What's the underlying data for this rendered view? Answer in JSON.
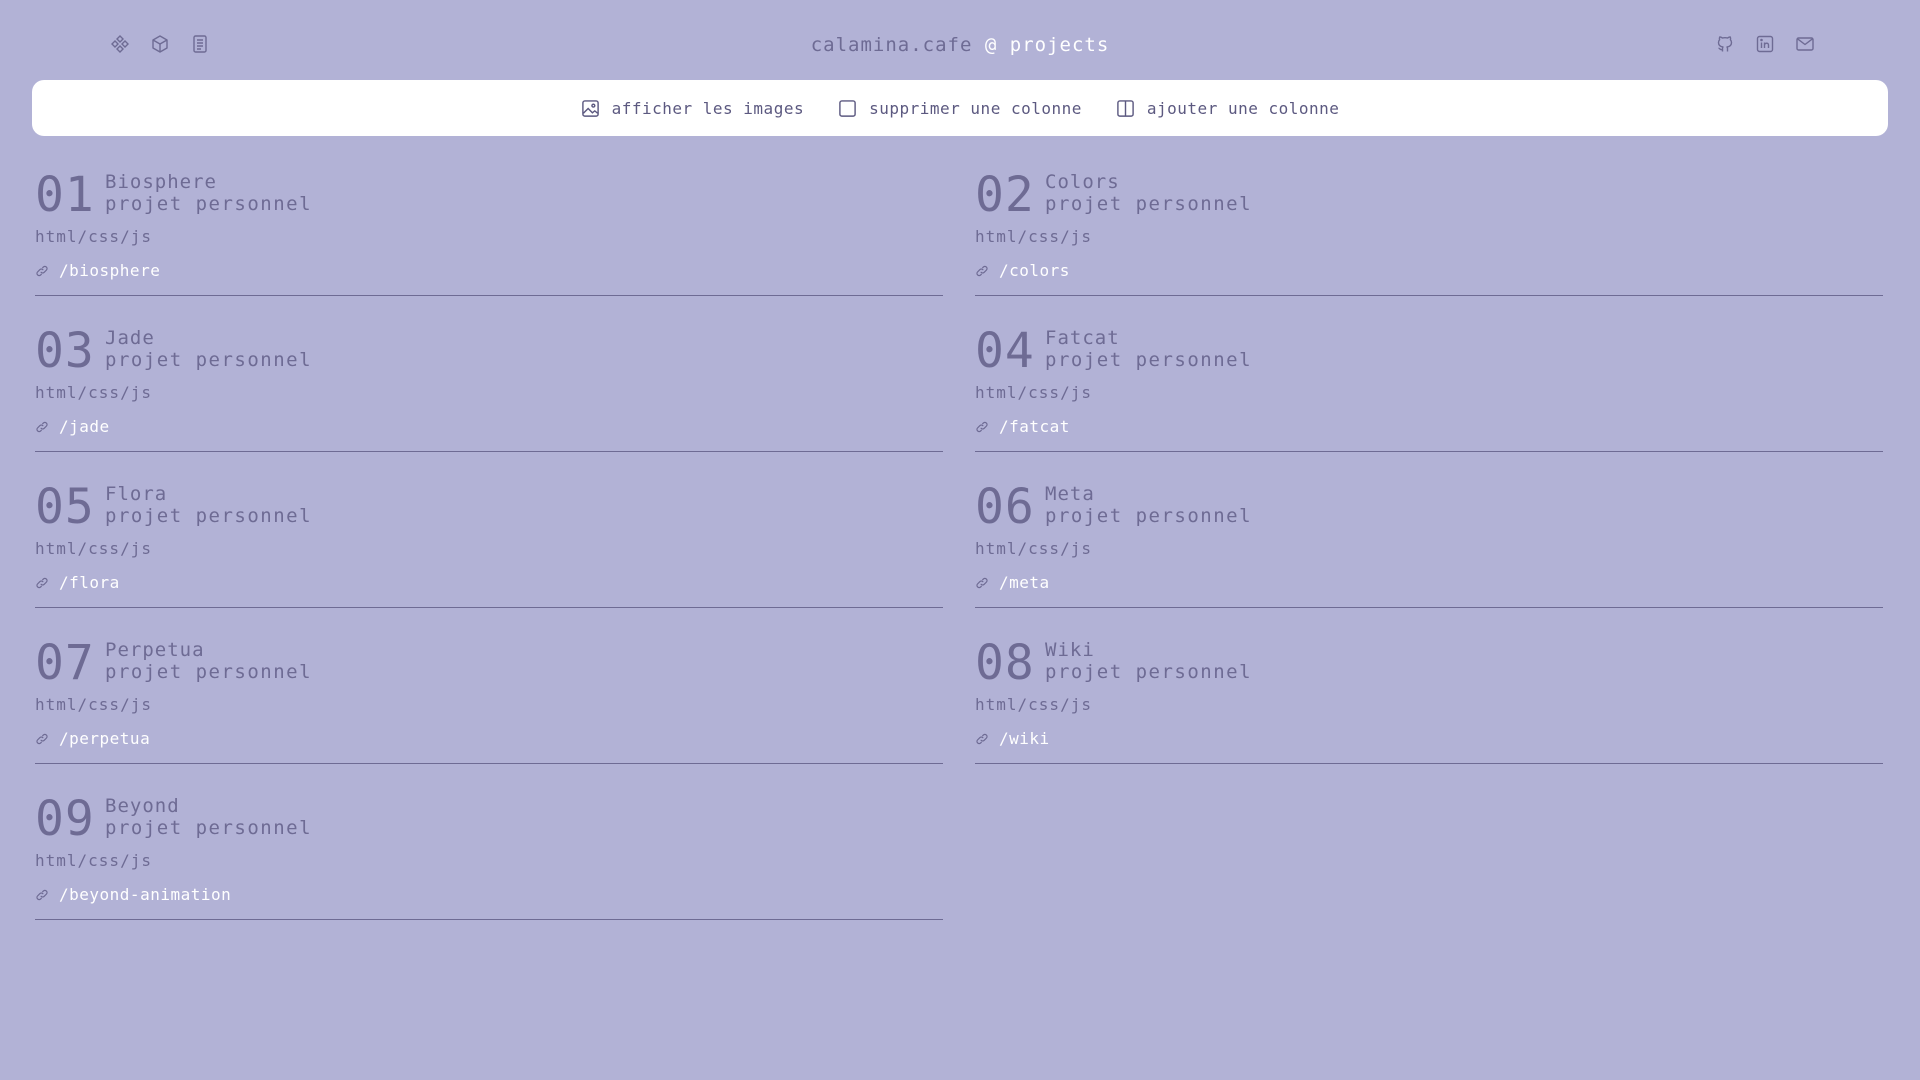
{
  "header": {
    "title_prefix": "calamina.cafe",
    "title_accent": "@ projects",
    "left_icons": [
      "diamonds-icon",
      "cube-icon",
      "document-icon"
    ],
    "right_icons": [
      "github-icon",
      "linkedin-icon",
      "mail-icon"
    ]
  },
  "toolbar": {
    "show_images": "afficher les images",
    "remove_column": "supprimer une colonne",
    "add_column": "ajouter une colonne"
  },
  "projects": [
    {
      "num": "01",
      "name": "Biosphere",
      "kind": "projet personnel",
      "tech": "html/css/js",
      "link": "/biosphere"
    },
    {
      "num": "02",
      "name": "Colors",
      "kind": "projet personnel",
      "tech": "html/css/js",
      "link": "/colors"
    },
    {
      "num": "03",
      "name": "Jade",
      "kind": "projet personnel",
      "tech": "html/css/js",
      "link": "/jade"
    },
    {
      "num": "04",
      "name": "Fatcat",
      "kind": "projet personnel",
      "tech": "html/css/js",
      "link": "/fatcat"
    },
    {
      "num": "05",
      "name": "Flora",
      "kind": "projet personnel",
      "tech": "html/css/js",
      "link": "/flora"
    },
    {
      "num": "06",
      "name": "Meta",
      "kind": "projet personnel",
      "tech": "html/css/js",
      "link": "/meta"
    },
    {
      "num": "07",
      "name": "Perpetua",
      "kind": "projet personnel",
      "tech": "html/css/js",
      "link": "/perpetua"
    },
    {
      "num": "08",
      "name": "Wiki",
      "kind": "projet personnel",
      "tech": "html/css/js",
      "link": "/wiki"
    },
    {
      "num": "09",
      "name": "Beyond",
      "kind": "projet personnel",
      "tech": "html/css/js",
      "link": "/beyond-animation"
    }
  ],
  "colors": {
    "background": "#b2b2d6",
    "text": "#6e6b94",
    "accent": "#ffffff",
    "toolbar_bg": "#ffffff"
  }
}
